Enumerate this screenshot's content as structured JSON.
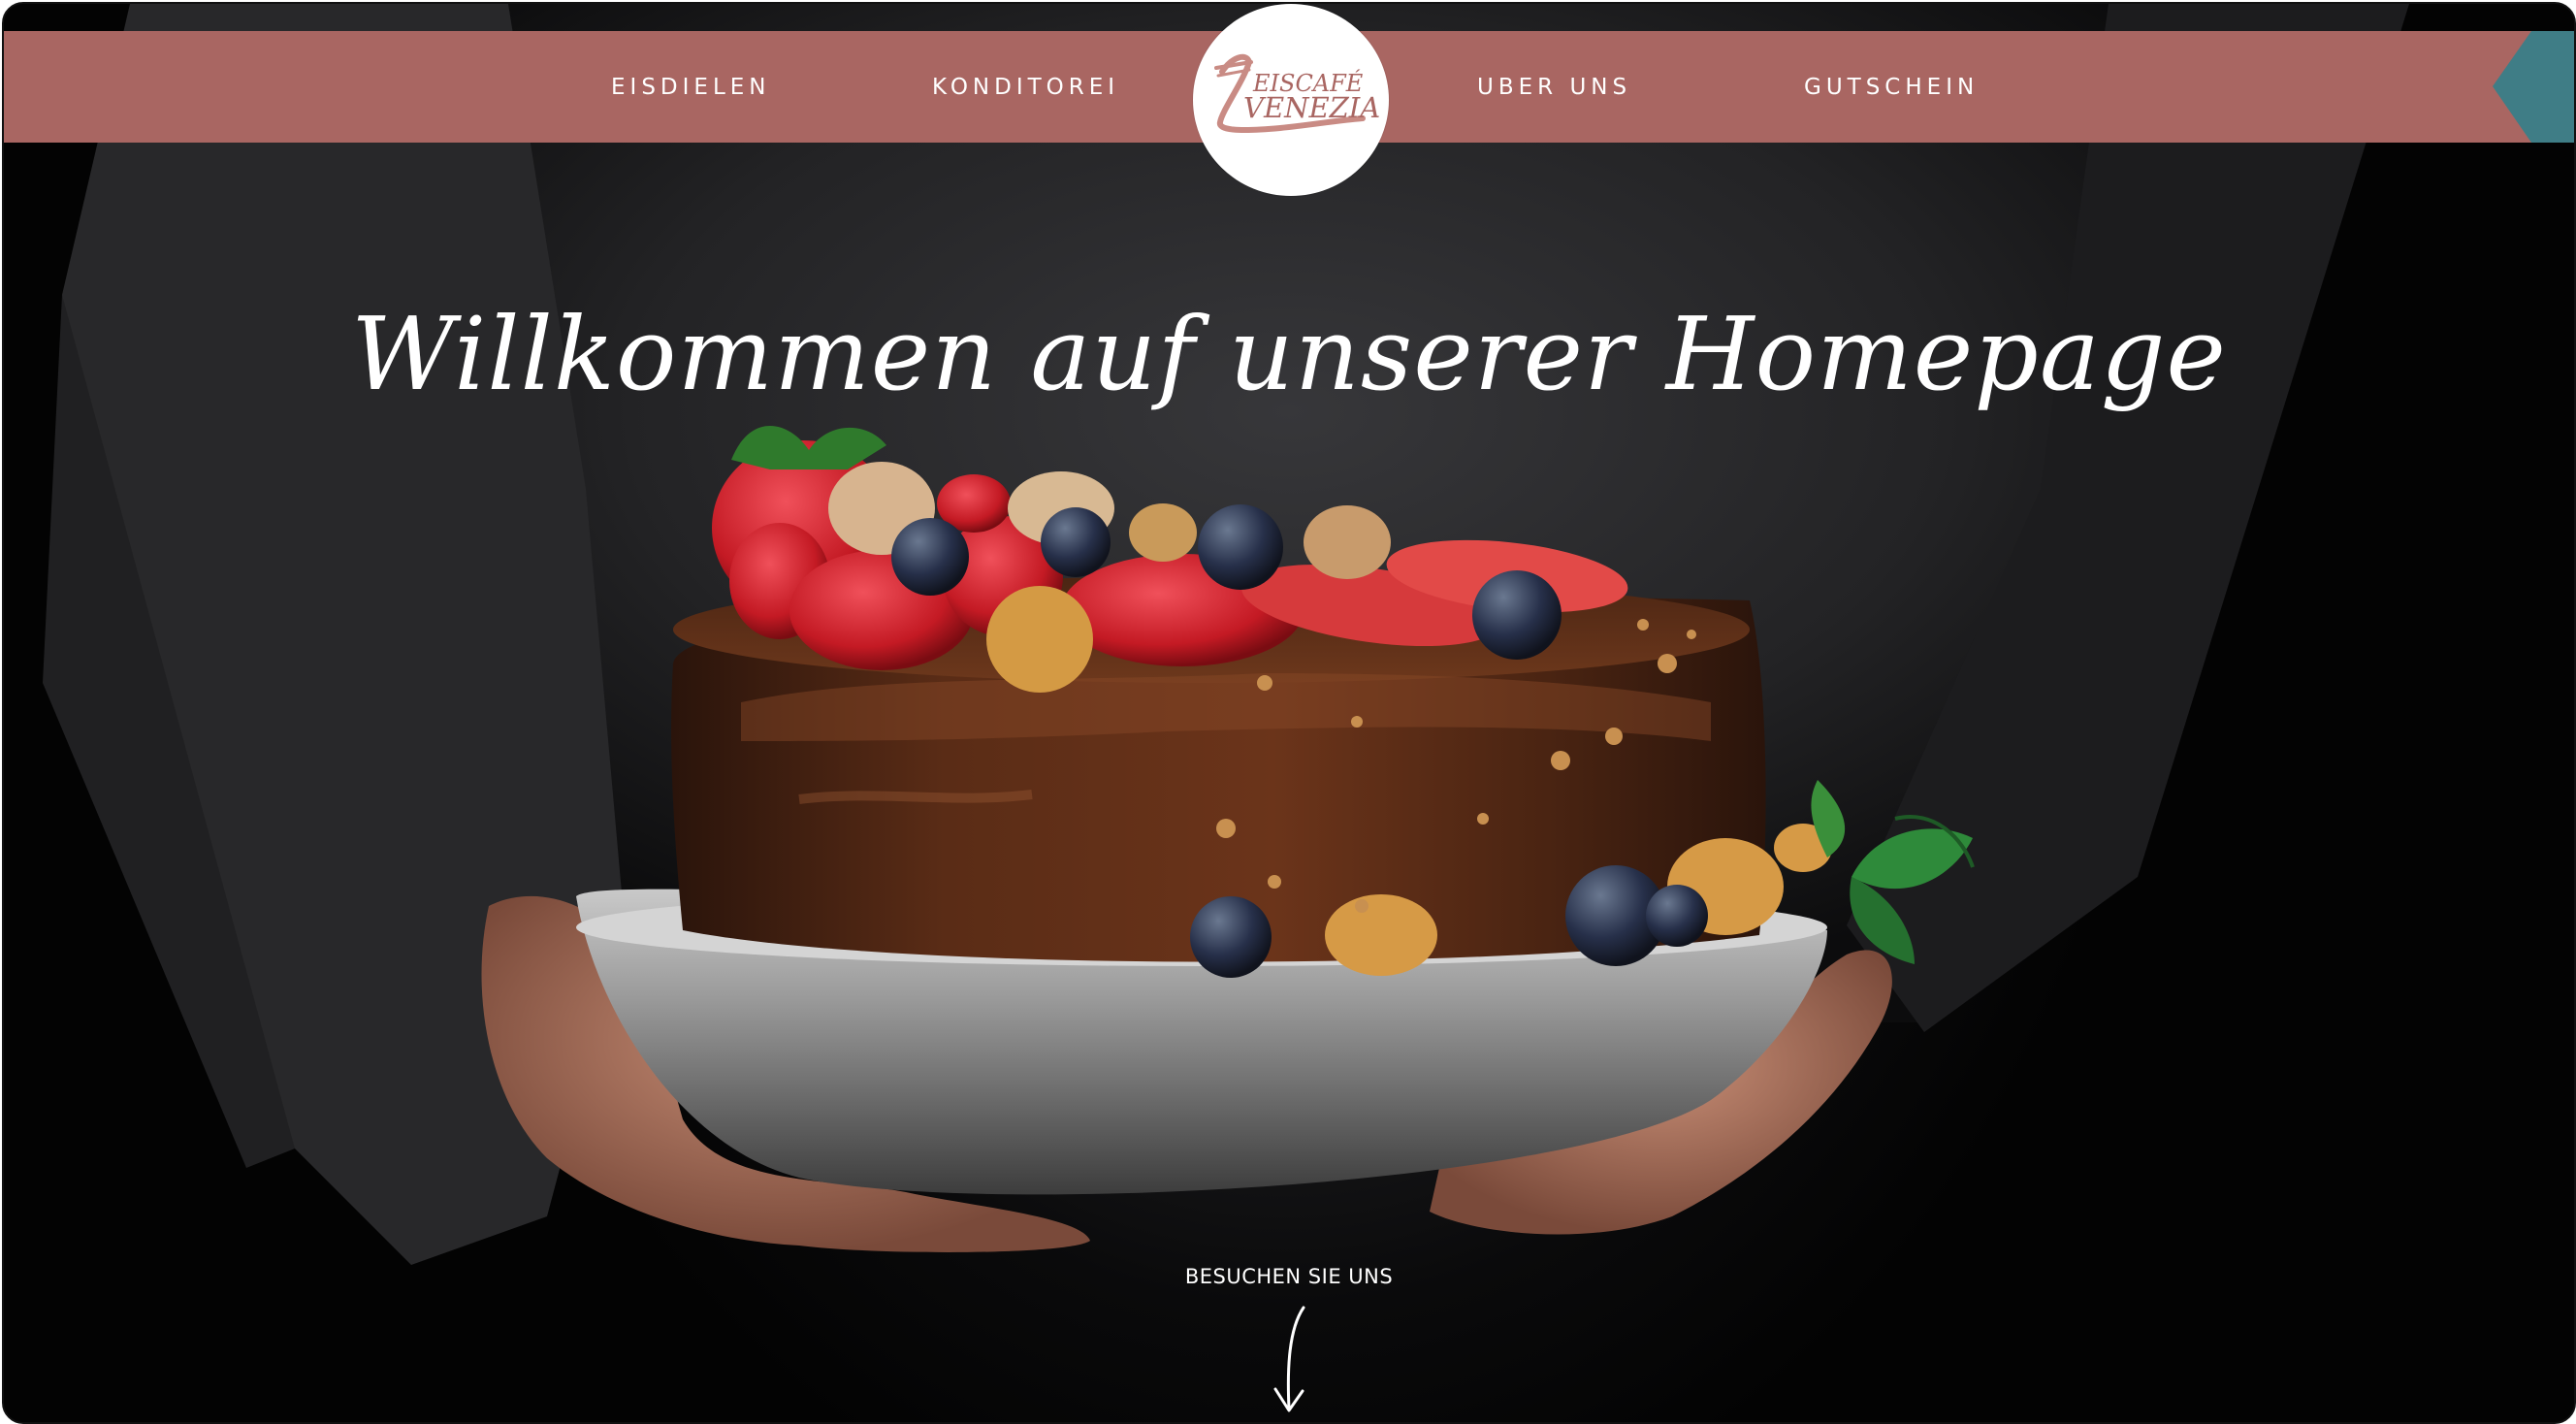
{
  "nav": {
    "left_items": [
      {
        "label": "EISDIELEN"
      },
      {
        "label": "KONDITOREI"
      }
    ],
    "right_items": [
      {
        "label": "UBER UNS"
      },
      {
        "label": "GUTSCHEIN"
      }
    ],
    "logo": {
      "line1": "EISCAFÉ",
      "line2": "VENEZIA"
    },
    "bar_color": "#a96662",
    "corner_tab_color": "#3f7d86",
    "corner_icon": "arrow-left-icon"
  },
  "hero": {
    "headline": "Willkommen auf unserer Homepage",
    "image": "chocolate-cake-photo"
  },
  "cta": {
    "label": "BESUCHEN SIE UNS",
    "icon": "arrow-down-icon"
  }
}
